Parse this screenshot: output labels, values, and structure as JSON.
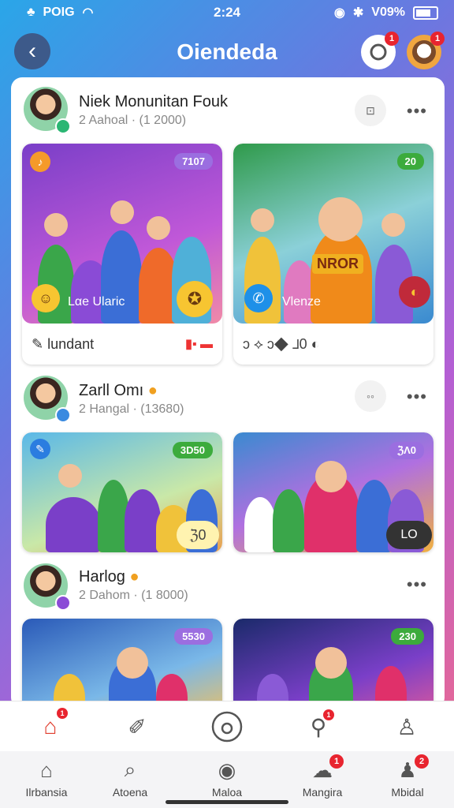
{
  "status": {
    "carrier": "POIG",
    "time": "2:24",
    "battery": "V09%"
  },
  "header": {
    "title": "Oiendeda",
    "notif_badge": "1",
    "profile_badge": "1"
  },
  "posts": [
    {
      "name": "Niek Monunitan Fouk",
      "meta": "2 Aahoal · (1 2000)",
      "more": "•••",
      "tiles": [
        {
          "tag": "7107",
          "label": "Lαe Ularic",
          "footer": "lundant",
          "footer_icons": "▮▪ ▬"
        },
        {
          "tag": "20",
          "label": "Vlenze",
          "sign": "NROR",
          "footer_icons": "ↄ ⟡   ↄ◆ ⅃0   ◐"
        }
      ]
    },
    {
      "name": "Zarll Omı",
      "meta": "2 Hangal · (13680)",
      "more": "•••",
      "tiles": [
        {
          "tag": "3D50",
          "chip": "ℨ0"
        },
        {
          "tag": "ℨΛ0",
          "chip": "LO"
        }
      ]
    },
    {
      "name": "Harlog",
      "meta": "2 Dahom · (1 8000)",
      "more": "•••",
      "tiles": [
        {
          "tag": "5530"
        },
        {
          "tag": "230"
        }
      ]
    }
  ],
  "nav_top": {
    "home_badge": "1",
    "mic_badge": "1"
  },
  "nav_bottom": [
    {
      "label": "Ilrbansia",
      "icon": "home-icon"
    },
    {
      "label": "Atoena",
      "icon": "search-icon"
    },
    {
      "label": "Maloa",
      "icon": "record-icon"
    },
    {
      "label": "Mangira",
      "icon": "chat-icon",
      "badge": "1"
    },
    {
      "label": "Mbidal",
      "icon": "profile-icon",
      "badge": "2"
    }
  ]
}
